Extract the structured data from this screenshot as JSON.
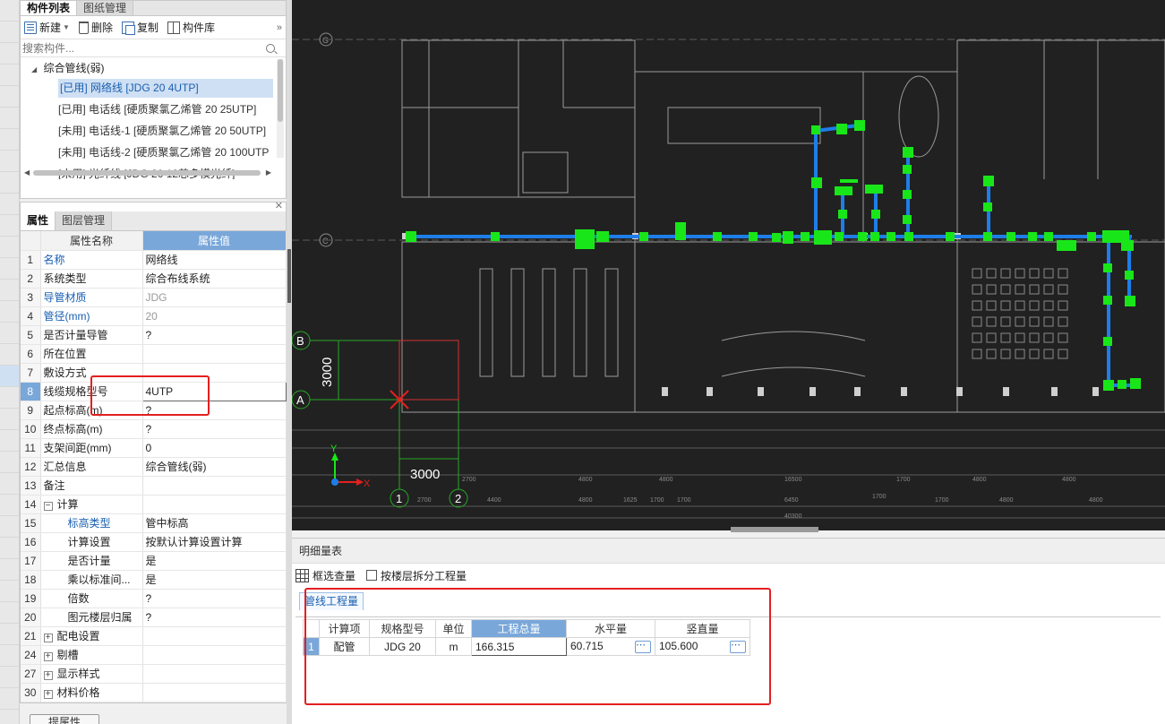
{
  "component_panel": {
    "tabs": [
      "构件列表",
      "图纸管理"
    ],
    "toolbar": {
      "new_label": "新建",
      "delete_label": "删除",
      "copy_label": "复制",
      "library_label": "构件库",
      "more": "»"
    },
    "search_placeholder": "搜索构件...",
    "tree": {
      "parent": "综合管线(弱)",
      "items": [
        {
          "status": "[已用]",
          "label": "网络线 [JDG 20 4UTP]",
          "selected": true
        },
        {
          "status": "[已用]",
          "label": "电话线 [硬质聚氯乙烯管 20 25UTP]",
          "selected": false
        },
        {
          "status": "[未用]",
          "label": "电话线-1 [硬质聚氯乙烯管 20 50UTP]",
          "selected": false
        },
        {
          "status": "[未用]",
          "label": "电话线-2 [硬质聚氯乙烯管 20 100UTP",
          "selected": false
        },
        {
          "status": "[未用]",
          "label": "光纤线 [JDG 20 12芯多模光纤]",
          "selected": false
        }
      ]
    }
  },
  "property_panel": {
    "tabs": [
      "属性",
      "图层管理"
    ],
    "headers": {
      "name": "属性名称",
      "value": "属性值"
    },
    "rows": [
      {
        "no": "1",
        "name": "名称",
        "value": "网络线",
        "blue": true,
        "gray": false,
        "indent": false,
        "group": false
      },
      {
        "no": "2",
        "name": "系统类型",
        "value": "综合布线系统",
        "blue": false,
        "gray": false,
        "indent": false,
        "group": false
      },
      {
        "no": "3",
        "name": "导管材质",
        "value": "JDG",
        "blue": true,
        "gray": true,
        "indent": false,
        "group": false
      },
      {
        "no": "4",
        "name": "管径(mm)",
        "value": "20",
        "blue": true,
        "gray": true,
        "indent": false,
        "group": false
      },
      {
        "no": "5",
        "name": "是否计量导管",
        "value": "?",
        "blue": false,
        "gray": false,
        "indent": false,
        "group": false
      },
      {
        "no": "6",
        "name": "所在位置",
        "value": "",
        "blue": false,
        "gray": false,
        "indent": false,
        "group": false
      },
      {
        "no": "7",
        "name": "敷设方式",
        "value": "",
        "blue": false,
        "gray": false,
        "indent": false,
        "group": false
      },
      {
        "no": "8",
        "name": "线缆规格型号",
        "value": "4UTP",
        "blue": false,
        "gray": false,
        "indent": false,
        "group": false,
        "selected": true
      },
      {
        "no": "9",
        "name": "起点标高(m)",
        "value": "?",
        "blue": false,
        "gray": false,
        "indent": false,
        "group": false
      },
      {
        "no": "10",
        "name": "终点标高(m)",
        "value": "?",
        "blue": false,
        "gray": false,
        "indent": false,
        "group": false
      },
      {
        "no": "11",
        "name": "支架间距(mm)",
        "value": "0",
        "blue": false,
        "gray": false,
        "indent": false,
        "group": false
      },
      {
        "no": "12",
        "name": "汇总信息",
        "value": "综合管线(弱)",
        "blue": false,
        "gray": false,
        "indent": false,
        "group": false
      },
      {
        "no": "13",
        "name": "备注",
        "value": "",
        "blue": false,
        "gray": false,
        "indent": false,
        "group": false
      },
      {
        "no": "14",
        "name": "计算",
        "value": "",
        "blue": false,
        "gray": false,
        "indent": false,
        "group": true,
        "expander": "−"
      },
      {
        "no": "15",
        "name": "标高类型",
        "value": "管中标高",
        "blue": true,
        "gray": false,
        "indent": true,
        "group": false
      },
      {
        "no": "16",
        "name": "计算设置",
        "value": "按默认计算设置计算",
        "blue": false,
        "gray": false,
        "indent": true,
        "group": false
      },
      {
        "no": "17",
        "name": "是否计量",
        "value": "是",
        "blue": false,
        "gray": false,
        "indent": true,
        "group": false
      },
      {
        "no": "18",
        "name": "乘以标准间...",
        "value": "是",
        "blue": false,
        "gray": false,
        "indent": true,
        "group": false
      },
      {
        "no": "19",
        "name": "倍数",
        "value": "?",
        "blue": false,
        "gray": false,
        "indent": true,
        "group": false
      },
      {
        "no": "20",
        "name": "图元楼层归属",
        "value": "?",
        "blue": false,
        "gray": false,
        "indent": true,
        "group": false
      },
      {
        "no": "21",
        "name": "配电设置",
        "value": "",
        "blue": false,
        "gray": false,
        "indent": false,
        "group": true,
        "expander": "+"
      },
      {
        "no": "24",
        "name": "剔槽",
        "value": "",
        "blue": false,
        "gray": false,
        "indent": false,
        "group": true,
        "expander": "+"
      },
      {
        "no": "27",
        "name": "显示样式",
        "value": "",
        "blue": false,
        "gray": false,
        "indent": false,
        "group": true,
        "expander": "+"
      },
      {
        "no": "30",
        "name": "材料价格",
        "value": "",
        "blue": false,
        "gray": false,
        "indent": false,
        "group": true,
        "expander": "+"
      }
    ],
    "bottom_button": "提属性"
  },
  "canvas": {
    "axis_labels": {
      "B": "B",
      "A": "A",
      "one": "1",
      "two": "2",
      "G": "G",
      "C": "C"
    },
    "dims": {
      "vertical": "3000",
      "horizontal": "3000"
    },
    "axis_x": "X",
    "axis_y": "Y",
    "bottom_dims_top": [
      "2700",
      "4800",
      "4800",
      "16500",
      "1700",
      "4800",
      "4800"
    ],
    "bottom_dims_mid": [
      "2700",
      "4400",
      "4800",
      "1625",
      "1700",
      "1700",
      "6450",
      "1700",
      "1700",
      "4800",
      "4800"
    ],
    "bottom_total": "40300",
    "colors": {
      "background": "#212121",
      "pipe": "#1e7ee8",
      "node": "#19e619",
      "dim": "#28a828",
      "cursor": "#e41f1f"
    }
  },
  "quantity_panel": {
    "title": "明细量表",
    "tools": {
      "box_select": "框选查量",
      "split_by_floor": "按楼层拆分工程量"
    },
    "tab": "管线工程量",
    "headers": [
      "计算项",
      "规格型号",
      "单位",
      "工程总量",
      "水平量",
      "竖直量"
    ],
    "rows": [
      {
        "no": "1",
        "item": "配管",
        "spec": "JDG 20",
        "unit": "m",
        "total": "166.315",
        "horizontal": "60.715",
        "vertical": "105.600"
      }
    ],
    "ellipsis": "⋯"
  }
}
